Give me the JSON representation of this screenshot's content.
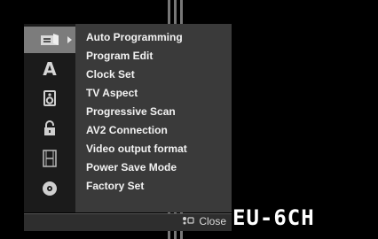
{
  "menu": {
    "icons": [
      {
        "name": "disc-player-icon",
        "active": true
      },
      {
        "name": "language-icon",
        "glyph": "A"
      },
      {
        "name": "speaker-icon"
      },
      {
        "name": "lock-icon"
      },
      {
        "name": "film-icon"
      },
      {
        "name": "dvd-disc-icon"
      }
    ],
    "items": [
      "Auto Programming",
      "Program Edit",
      "Clock Set",
      "TV Aspect",
      "Progressive Scan",
      "AV2 Connection",
      "Video output format",
      "Power Save Mode",
      "Factory Set"
    ],
    "close_label": "Close"
  },
  "channel_display": "EU-6CH"
}
